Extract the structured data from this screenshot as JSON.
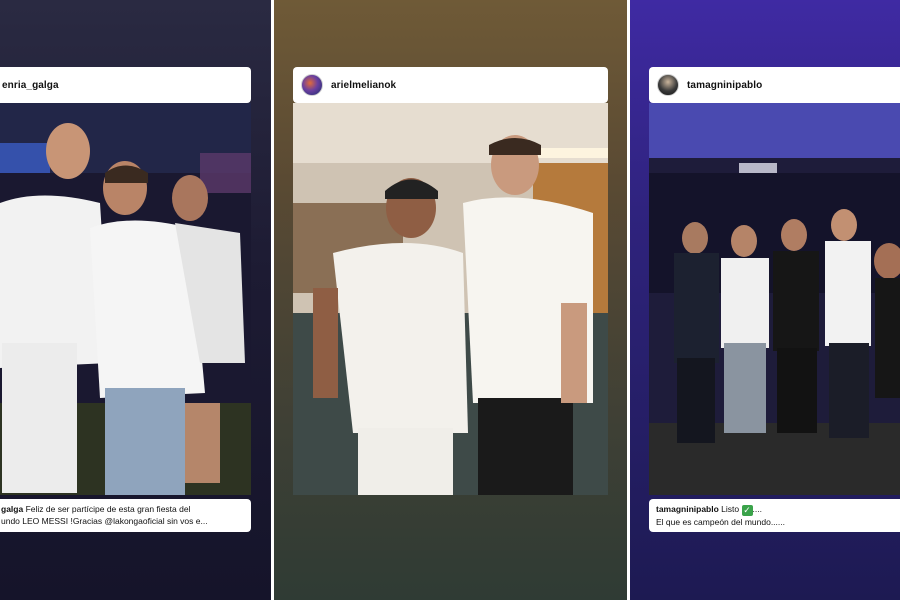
{
  "stories": [
    {
      "username": "enria_galga",
      "caption": {
        "user": "galga",
        "line1": " Feliz de ser partícipe de esta gran fiesta del",
        "line2": "undo LEO MESSI !Gracias @lakongaoficial sin vos e..."
      }
    },
    {
      "username": "arielmelianok",
      "avatar_icon": "profile-avatar-icon"
    },
    {
      "username": "tamagninipablo",
      "avatar_icon": "profile-avatar-icon",
      "caption": {
        "user": "tamagninipablo",
        "line1_text": " Listo ",
        "emoji": "✓",
        "emoji_name": "check-mark-button-icon",
        "line1_tail": "....",
        "line2": "El que es campeón del mundo......"
      }
    }
  ],
  "colors": {
    "story1_bg": "#1d1b33",
    "story2_bg": "#5a4a33",
    "story3_bg": "#2f237e",
    "card_white": "#ffffff",
    "emoji_green": "#3aa34a"
  }
}
